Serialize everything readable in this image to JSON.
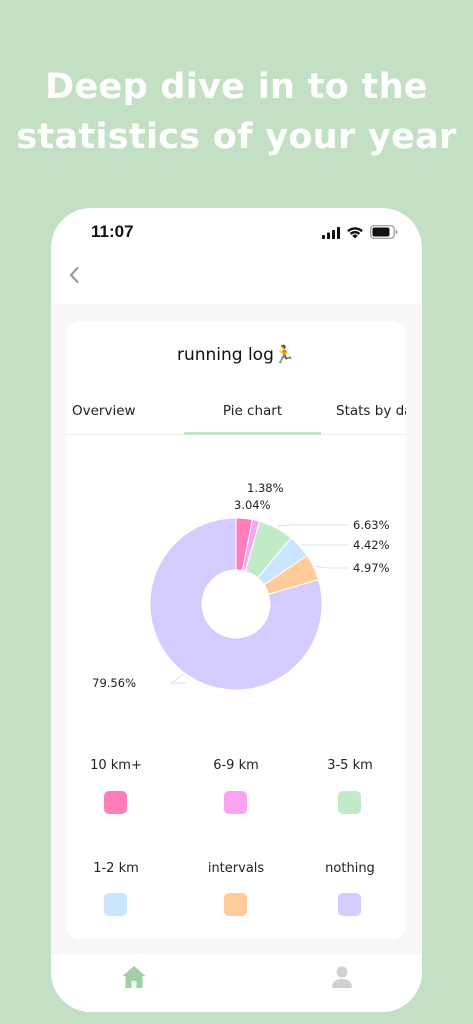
{
  "headline": {
    "line1": "Deep dive in to the",
    "line2": "statistics of your year"
  },
  "status_bar": {
    "time": "11:07"
  },
  "card": {
    "title": "running log🏃"
  },
  "tabs": [
    {
      "label": "Overview"
    },
    {
      "label": "Pie chart",
      "active": true
    },
    {
      "label": "Stats by day"
    }
  ],
  "chart_data": {
    "type": "pie",
    "donut": true,
    "slices": [
      {
        "label": "10 km+",
        "value": 3.04,
        "value_label": "3.04%",
        "color": "#ff7eb9"
      },
      {
        "label": "6-9 km",
        "value": 1.38,
        "value_label": "1.38%",
        "color": "#fba2f1"
      },
      {
        "label": "3-5 km",
        "value": 6.63,
        "value_label": "6.63%",
        "color": "#c1ebc8"
      },
      {
        "label": "1-2 km",
        "value": 4.42,
        "value_label": "4.42%",
        "color": "#cce5ff"
      },
      {
        "label": "intervals",
        "value": 4.97,
        "value_label": "4.97%",
        "color": "#ffcc99"
      },
      {
        "label": "nothing",
        "value": 79.56,
        "value_label": "79.56%",
        "color": "#d4ccff"
      }
    ],
    "legend_position": "bottom"
  },
  "colors": {
    "background": "#c3e0c5",
    "accent": "#c6e3c7",
    "tab_icon_active": "#9fd1a4",
    "tab_icon_inactive": "#d0d0d0"
  },
  "icons": {
    "back": "chevron-left-icon",
    "home": "home-icon",
    "profile": "person-icon"
  }
}
